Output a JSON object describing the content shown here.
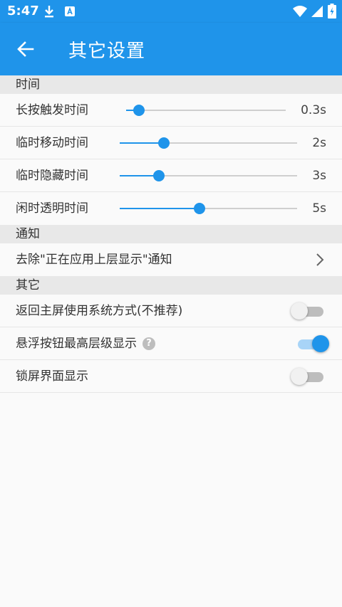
{
  "status_bar": {
    "time": "5:47"
  },
  "app_bar": {
    "title": "其它设置"
  },
  "sections": {
    "time": {
      "header": "时间",
      "rows": [
        {
          "label": "长按触发时间",
          "value": "0.3s",
          "fraction": 0.08
        },
        {
          "label": "临时移动时间",
          "value": "2s",
          "fraction": 0.25
        },
        {
          "label": "临时隐藏时间",
          "value": "3s",
          "fraction": 0.22
        },
        {
          "label": "闲时透明时间",
          "value": "5s",
          "fraction": 0.45
        }
      ]
    },
    "notify": {
      "header": "通知",
      "rows": [
        {
          "label": "去除\"正在应用上层显示\"通知"
        }
      ]
    },
    "other": {
      "header": "其它",
      "rows": [
        {
          "label": "返回主屏使用系统方式(不推荐)",
          "enabled": false
        },
        {
          "label": "悬浮按钮最高层级显示",
          "help": "?",
          "enabled": true
        },
        {
          "label": "锁屏界面显示",
          "enabled": false
        }
      ]
    }
  },
  "colors": {
    "primary": "#1f94ea",
    "track": "#cfcfcf",
    "toggle_off": "#bdbdbd"
  },
  "icons": [
    "download-icon",
    "a-badge-icon",
    "wifi-icon",
    "signal-icon",
    "battery-charging-icon",
    "back-arrow-icon",
    "chevron-right-icon",
    "help-icon"
  ]
}
